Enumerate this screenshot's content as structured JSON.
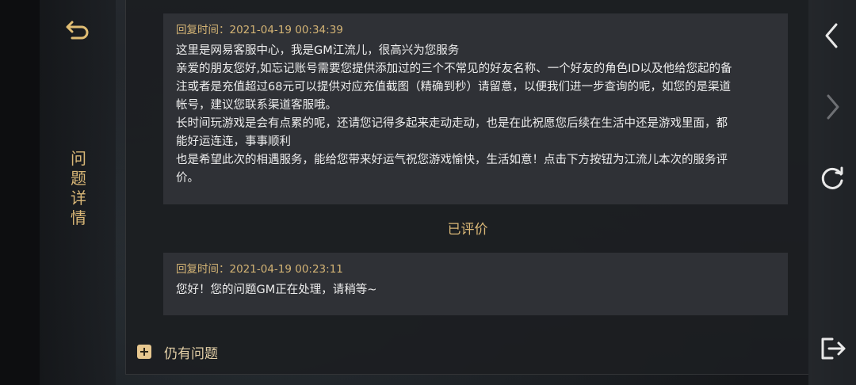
{
  "sidebar": {
    "title": "问题详情",
    "back_icon": "back-arrow-icon"
  },
  "messages": [
    {
      "time_label": "回复时间：2021-04-19 00:34:39",
      "lines": [
        "这里是网易客服中心，我是GM江流儿，很高兴为您服务",
        "亲爱的朋友您好,如忘记账号需要您提供添加过的三个不常见的好友名称、一个好友的角色ID以及他给您起的备",
        "注或者是充值超过68元可以提供对应充值截图（精确到秒）请留意，以便我们进一步查询的呢，如您的是渠道",
        "帐号，建议您联系渠道客服哦。",
        "长时间玩游戏是会有点累的呢，还请您记得多起来走动走动，也是在此祝愿您后续在生活中还是游戏里面，都",
        "能好运连连，事事顺利",
        "也是希望此次的相遇服务，能给您带来好运气祝您游戏愉快，生活如意！点击下方按钮为江流儿本次的服务评",
        "价。"
      ]
    },
    {
      "time_label": "回复时间：2021-04-19 00:23:11",
      "lines": [
        "您好！您的问题GM正在处理，请稍等~"
      ]
    }
  ],
  "rated_label": "已评价",
  "still_issue_label": "仍有问题",
  "right_nav": {
    "back": "chevron-left-icon",
    "forward": "chevron-right-icon",
    "refresh": "refresh-icon",
    "exit": "exit-icon"
  },
  "colors": {
    "accent_gold": "#d9b777",
    "text_light": "#ededed"
  }
}
